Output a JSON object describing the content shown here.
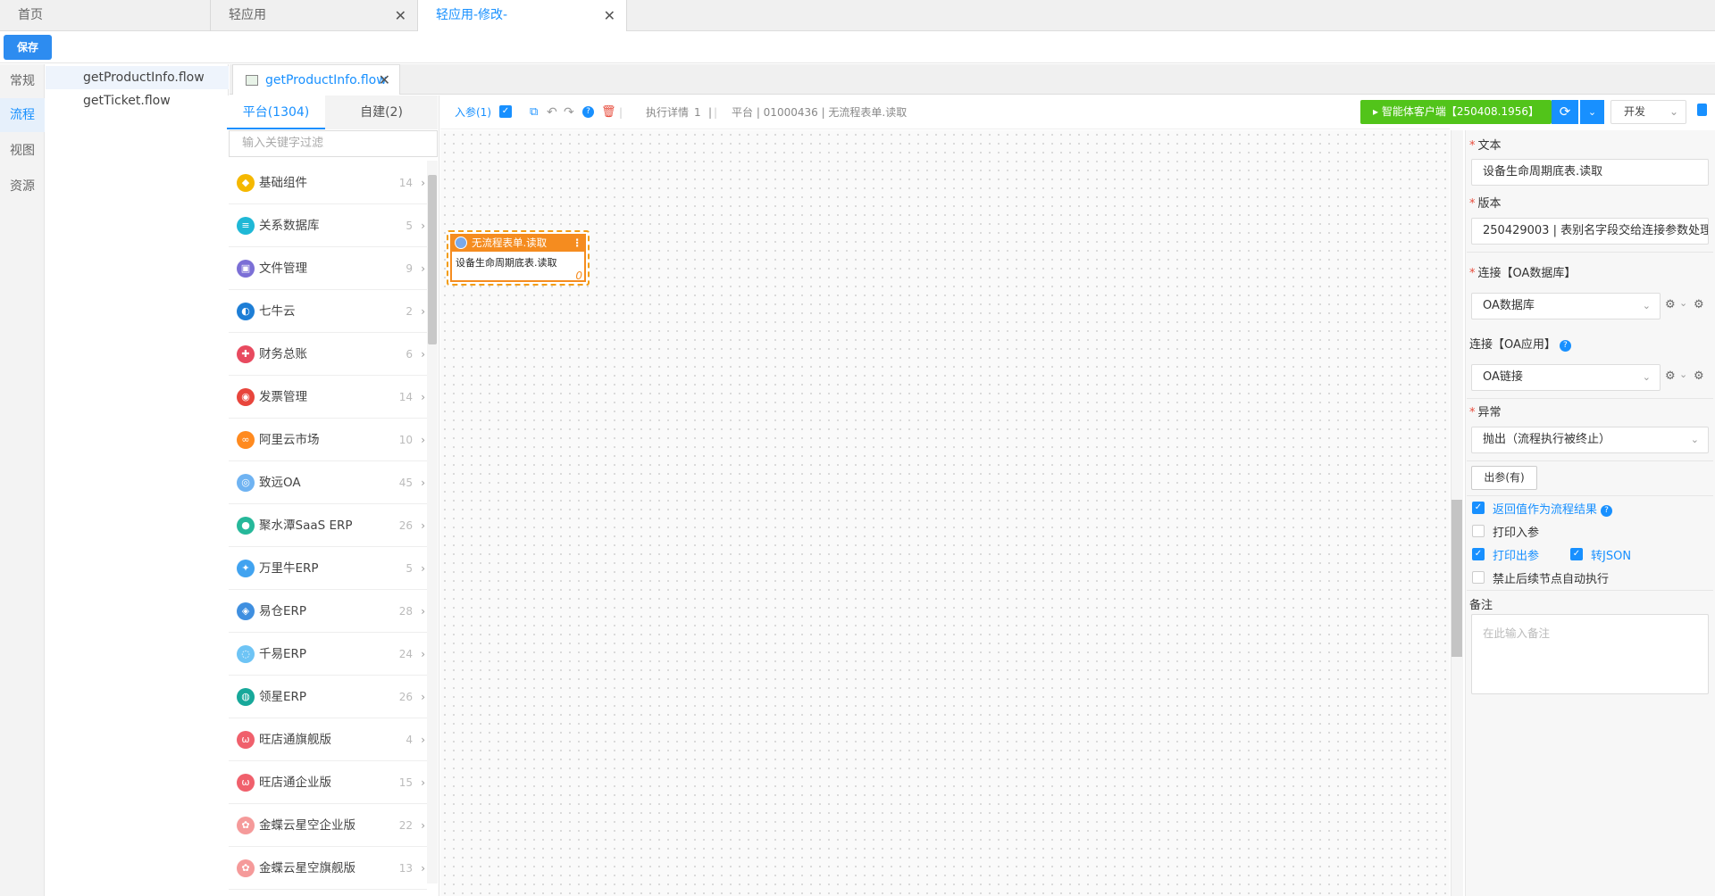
{
  "top_tabs": [
    {
      "label": "首页"
    },
    {
      "label": "轻应用"
    },
    {
      "label": "轻应用-修改-"
    }
  ],
  "toolbar": {
    "save_label": "保存"
  },
  "left_nav": [
    "常规",
    "流程",
    "视图",
    "资源"
  ],
  "files": [
    "getProductInfo.flow",
    "getTicket.flow"
  ],
  "file_tab": {
    "label": "getProductInfo.flow"
  },
  "component_panel": {
    "tab_platform": "平台(1304)",
    "tab_custom": "自建(2)",
    "filter_placeholder": "输入关键字过滤",
    "items": [
      {
        "label": "基础组件",
        "count": "14",
        "color": "#f5b800"
      },
      {
        "label": "关系数据库",
        "count": "5",
        "color": "#1fb8d6"
      },
      {
        "label": "文件管理",
        "count": "9",
        "color": "#7b6fd6"
      },
      {
        "label": "七牛云",
        "count": "2",
        "color": "#1d7ed6"
      },
      {
        "label": "财务总账",
        "count": "6",
        "color": "#e84a5f"
      },
      {
        "label": "发票管理",
        "count": "14",
        "color": "#e8453c"
      },
      {
        "label": "阿里云市场",
        "count": "10",
        "color": "#ff8a1f"
      },
      {
        "label": "致远OA",
        "count": "45",
        "color": "#6fb3f2"
      },
      {
        "label": "聚水潭SaaS ERP",
        "count": "26",
        "color": "#26b89a"
      },
      {
        "label": "万里牛ERP",
        "count": "5",
        "color": "#41a3f0"
      },
      {
        "label": "易仓ERP",
        "count": "28",
        "color": "#3f8fe0"
      },
      {
        "label": "千易ERP",
        "count": "24",
        "color": "#6ec4f5"
      },
      {
        "label": "领星ERP",
        "count": "26",
        "color": "#17a89a"
      },
      {
        "label": "旺店通旗舰版",
        "count": "4",
        "color": "#f0606c"
      },
      {
        "label": "旺店通企业版",
        "count": "15",
        "color": "#f0606c"
      },
      {
        "label": "金蝶云星空企业版",
        "count": "22",
        "color": "#f59a9a"
      },
      {
        "label": "金蝶云星空旗舰版",
        "count": "13",
        "color": "#f59a9a"
      }
    ]
  },
  "canvas_toolbar": {
    "params_in": "入参(1)",
    "exec_detail": "执行详情",
    "exec_count": "1",
    "breadcrumb": "平台 | 01000436 | 无流程表单.读取"
  },
  "node": {
    "title": "无流程表单.读取",
    "body": "设备生命周期底表.读取",
    "index": "0"
  },
  "run_button": {
    "label": "智能体客户端【250408.1956】"
  },
  "env_select": {
    "value": "开发"
  },
  "props": {
    "text_label": "文本",
    "text_value": "设备生命周期底表.读取",
    "version_label": "版本",
    "version_value": "250429003 | 表别名字段交给连接参数处理",
    "conn_db_label": "连接【OA数据库】",
    "conn_db_value": "OA数据库",
    "conn_app_label": "连接【OA应用】",
    "conn_app_value": "OA链接",
    "exception_label": "异常",
    "exception_value": "抛出（流程执行被终止）",
    "outparam_btn": "出参(有)",
    "chk_return": "返回值作为流程结果",
    "chk_print_in": "打印入参",
    "chk_print_out": "打印出参",
    "chk_json": "转JSON",
    "chk_disable_next": "禁止后续节点自动执行",
    "remark_label": "备注",
    "remark_placeholder": "在此输入备注"
  }
}
